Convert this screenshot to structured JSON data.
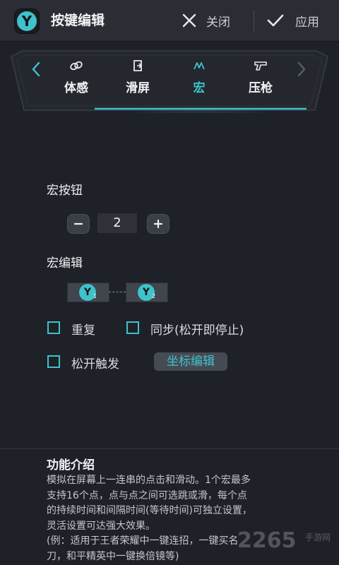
{
  "header": {
    "logo_letter": "Y",
    "title": "按键编辑",
    "close_label": "关闭",
    "apply_label": "应用"
  },
  "tabs": [
    {
      "label": "体感",
      "icon": "link-icon",
      "active": false
    },
    {
      "label": "滑屏",
      "icon": "swipe-icon",
      "active": false
    },
    {
      "label": "宏",
      "icon": "macro-icon",
      "active": true
    },
    {
      "label": "压枪",
      "icon": "gun-icon",
      "active": false
    }
  ],
  "macro_button": {
    "label": "宏按钮",
    "value": "2"
  },
  "macro_edit": {
    "label": "宏编辑",
    "nodes": [
      {
        "letter": "Y",
        "index": "1"
      },
      {
        "letter": "Y",
        "index": "2"
      }
    ]
  },
  "options": {
    "repeat": "重复",
    "sync": "同步(松开即停止)",
    "release_trigger": "松开触发",
    "coord_edit": "坐标编辑"
  },
  "intro": {
    "title": "功能介绍",
    "lines": [
      "模拟在屏幕上一连串的点击和滑动。1个宏最多",
      "支持16个点，点与点之间可选跳或滑，每个点",
      "的持续时间和间隔时间(等待时间)可独立设置，",
      "灵活设置可达强大效果。",
      "(例：适用于王者荣耀中一键连招，一键买名",
      "刀，和平精英中一键换倍镜等)"
    ]
  },
  "watermark": {
    "number": "2265",
    "text": "手游网"
  },
  "colors": {
    "accent": "#3fc2cc",
    "background": "#1e2128",
    "topbar": "#2a2d33"
  }
}
